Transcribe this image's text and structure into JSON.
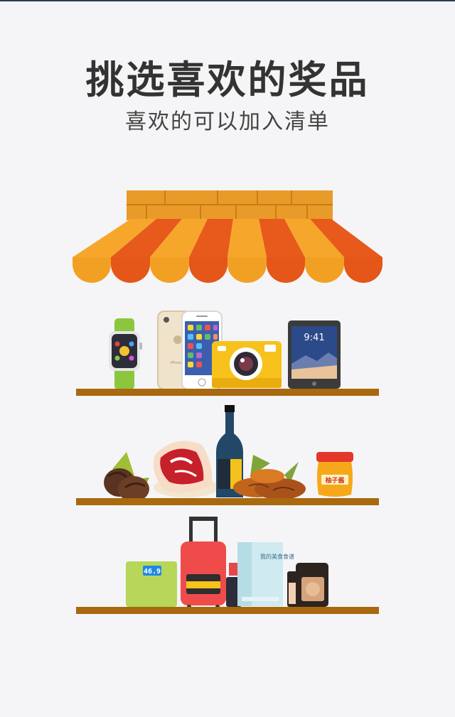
{
  "header": {
    "title": "挑选喜欢的奖品",
    "subtitle": "喜欢的可以加入清单"
  },
  "products": {
    "phone_brand": "iPhone",
    "tablet_time": "9:41",
    "honey_jar_label": "柚子酱",
    "scale_display": "46.9",
    "book_title": "我的美食食谱"
  },
  "colors": {
    "background": "#f5f5f7",
    "awning_orange": "#f49b22",
    "awning_red": "#e8521b",
    "brick": "#e99b2a",
    "shelf": "#a9690e"
  }
}
